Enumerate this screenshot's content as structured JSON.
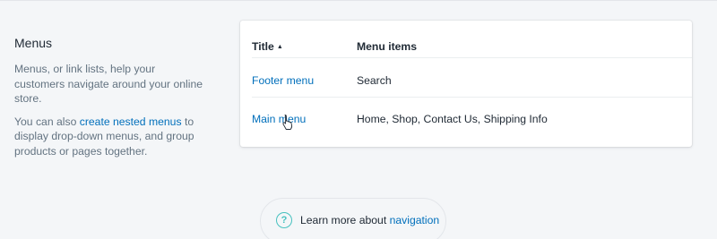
{
  "section": {
    "title": "Menus",
    "para1": "Menus, or link lists, help your customers navigate around your online store.",
    "para2_before": "You can also ",
    "para2_link": "create nested menus",
    "para2_after": " to display drop-down menus, and group products or pages together."
  },
  "table": {
    "col_title": "Title",
    "col_items": "Menu items",
    "sort_icon": "caret-up-icon",
    "rows": [
      {
        "title": "Footer menu",
        "items": "Search"
      },
      {
        "title": "Main menu",
        "items": "Home, Shop, Contact Us, Shipping Info"
      }
    ]
  },
  "learn_more": {
    "icon": "question-circle-icon",
    "text": "Learn more about ",
    "link": "navigation"
  },
  "colors": {
    "link": "#006fbb",
    "accent": "#47c1bf",
    "background": "#f4f6f8"
  }
}
